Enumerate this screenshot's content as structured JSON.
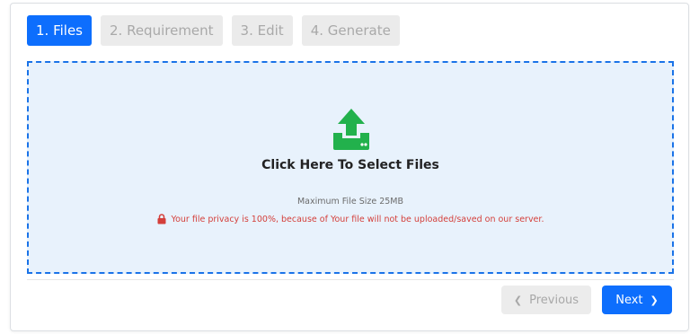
{
  "steps": [
    {
      "label": "1. Files",
      "active": true
    },
    {
      "label": "2. Requirement",
      "active": false
    },
    {
      "label": "3. Edit",
      "active": false
    },
    {
      "label": "4. Generate",
      "active": false
    }
  ],
  "dropzone": {
    "title": "Click Here To Select Files",
    "max_size": "Maximum File Size 25MB",
    "privacy": "Your file privacy is 100%, because of Your file will not be uploaded/saved on our server.",
    "icon": "upload-icon",
    "icon_color": "#22b14c"
  },
  "nav": {
    "previous_label": "Previous",
    "next_label": "Next",
    "previous_icon": "chevron-left-icon",
    "next_icon": "chevron-right-icon"
  },
  "colors": {
    "accent": "#0d6efd",
    "dropzone_border": "#1a73e8",
    "dropzone_bg": "#e8f2fc",
    "privacy_text": "#d43f3a"
  }
}
